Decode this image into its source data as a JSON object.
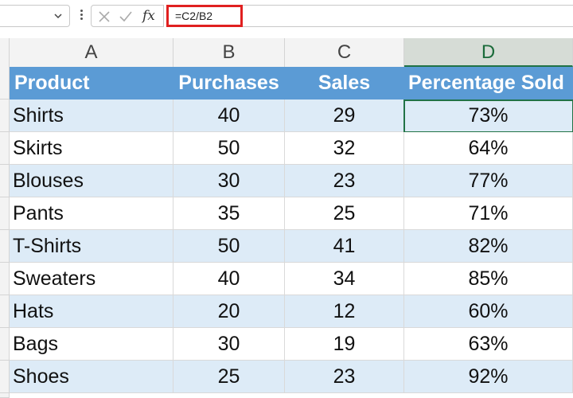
{
  "formula_bar": {
    "formula": "=C2/B2",
    "fx_label": "fx",
    "name_box_value": ""
  },
  "columns": [
    "A",
    "B",
    "C",
    "D"
  ],
  "active_column": "D",
  "table": {
    "headers": [
      "Product",
      "Purchases",
      "Sales",
      "Percentage Sold"
    ],
    "rows": [
      [
        "Shirts",
        "40",
        "29",
        "73%"
      ],
      [
        "Skirts",
        "50",
        "32",
        "64%"
      ],
      [
        "Blouses",
        "30",
        "23",
        "77%"
      ],
      [
        "Pants",
        "35",
        "25",
        "71%"
      ],
      [
        "T-Shirts",
        "50",
        "41",
        "82%"
      ],
      [
        "Sweaters",
        "40",
        "34",
        "85%"
      ],
      [
        "Hats",
        "20",
        "12",
        "60%"
      ],
      [
        "Bags",
        "30",
        "19",
        "63%"
      ],
      [
        "Shoes",
        "25",
        "23",
        "92%"
      ]
    ]
  },
  "colors": {
    "header_fill": "#5b9bd5",
    "band_fill": "#ddebf7",
    "selection": "#217346",
    "formula_highlight": "#e02020"
  },
  "icons": [
    "chevron-down-icon",
    "more-options-icon",
    "cancel-icon",
    "enter-icon",
    "insert-function-icon"
  ]
}
